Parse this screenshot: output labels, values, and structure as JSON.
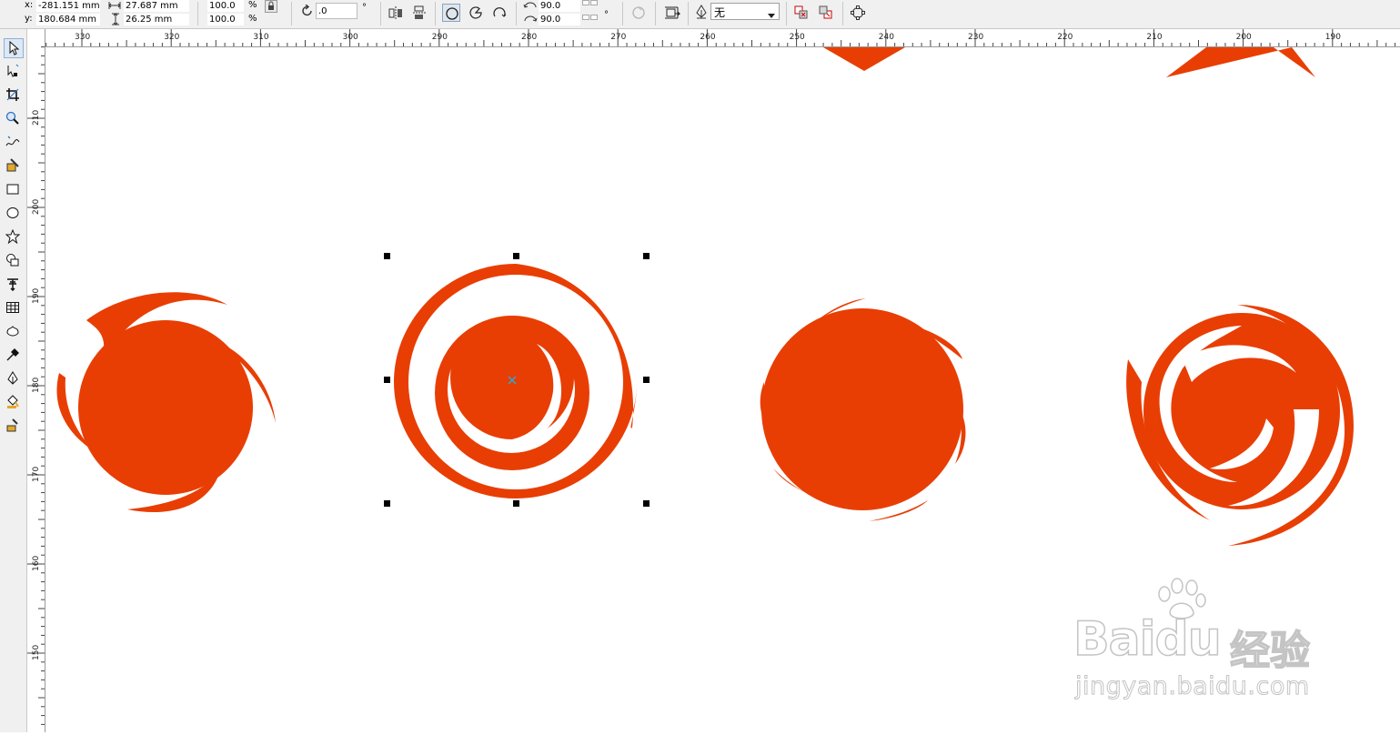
{
  "propbar": {
    "x_label": "x:",
    "y_label": "y:",
    "x_value": "-281.151 mm",
    "y_value": "180.684 mm",
    "width_value": "27.687 mm",
    "height_value": "26.25 mm",
    "scale_x": "100.0",
    "scale_y": "100.0",
    "percent1": "%",
    "percent2": "%",
    "rotation_value": ".0",
    "degree1": "°",
    "start_angle": "90.0",
    "end_angle": "90.0",
    "degree2": "°",
    "degree3": "°",
    "outline_width": "无"
  },
  "ruler": {
    "h_labels": [
      "330",
      "320",
      "310",
      "300",
      "290",
      "280",
      "270",
      "260",
      "250",
      "240",
      "230",
      "220",
      "210",
      "200",
      "190"
    ],
    "v_labels": [
      "210",
      "200",
      "190",
      "180",
      "170",
      "160",
      "150"
    ]
  },
  "colors": {
    "shape_fill": "#e83e04",
    "node_marker": "#29a9d6",
    "selection_handle": "#000000"
  },
  "tools": [
    "pick-tool-icon",
    "shape-tool-icon",
    "crop-tool-icon",
    "zoom-tool-icon",
    "freehand-tool-icon",
    "smart-fill-tool-icon",
    "rectangle-tool-icon",
    "ellipse-tool-icon",
    "polygon-tool-icon",
    "basic-shapes-tool-icon",
    "text-tool-icon",
    "table-tool-icon",
    "interactive-tool-icon",
    "eyedropper-tool-icon",
    "outline-tool-icon",
    "fill-tool-icon",
    "interactive-fill-tool-icon"
  ],
  "watermark": {
    "logo": "Baidu",
    "cn": "经验",
    "url": "jingyan.baidu.com"
  }
}
